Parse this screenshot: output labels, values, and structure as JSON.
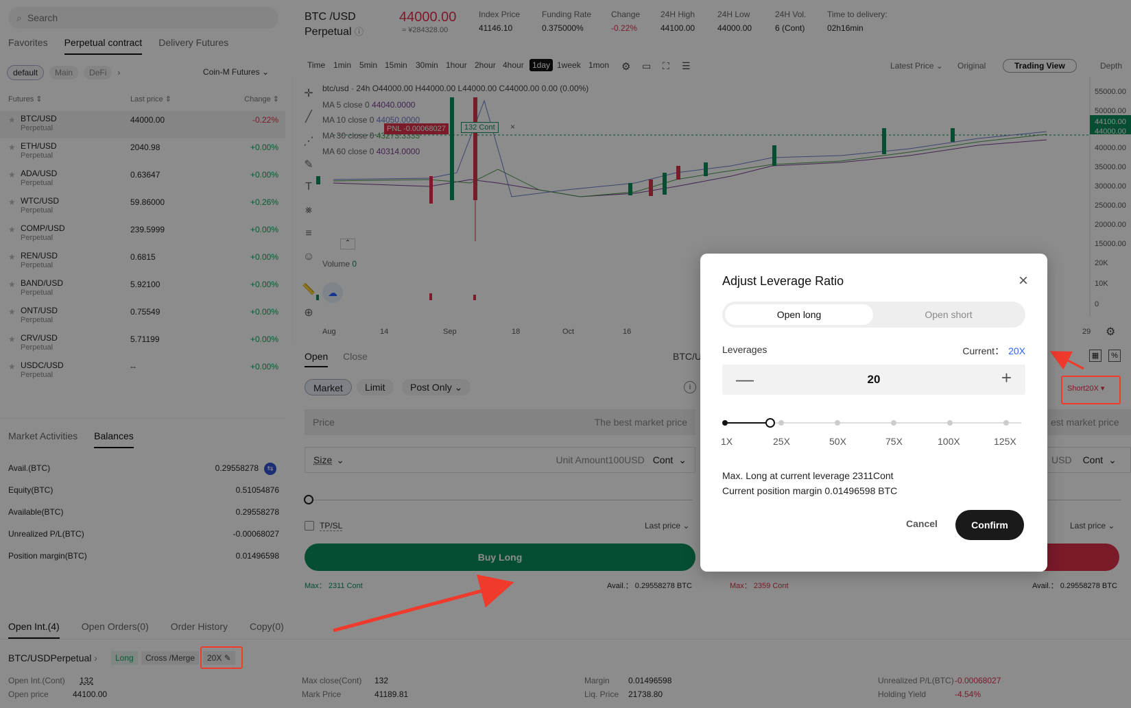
{
  "sidebar": {
    "search_placeholder": "Search",
    "tabs": [
      "Favorites",
      "Perpetual contract",
      "Delivery Futures"
    ],
    "chips": [
      "default",
      "Main",
      "DeFi"
    ],
    "coinm": "Coin-M Futures",
    "head": {
      "futures": "Futures",
      "last": "Last price",
      "change": "Change"
    },
    "items": [
      {
        "sym": "BTC/USD",
        "sub": "Perpetual",
        "px": "44000.00",
        "chg": "-0.22%"
      },
      {
        "sym": "ETH/USD",
        "sub": "Perpetual",
        "px": "2040.98",
        "chg": "+0.00%"
      },
      {
        "sym": "ADA/USD",
        "sub": "Perpetual",
        "px": "0.63647",
        "chg": "+0.00%"
      },
      {
        "sym": "WTC/USD",
        "sub": "Perpetual",
        "px": "59.86000",
        "chg": "+0.26%"
      },
      {
        "sym": "COMP/USD",
        "sub": "Perpetual",
        "px": "239.5999",
        "chg": "+0.00%"
      },
      {
        "sym": "REN/USD",
        "sub": "Perpetual",
        "px": "0.6815",
        "chg": "+0.00%"
      },
      {
        "sym": "BAND/USD",
        "sub": "Perpetual",
        "px": "5.92100",
        "chg": "+0.00%"
      },
      {
        "sym": "ONT/USD",
        "sub": "Perpetual",
        "px": "0.75549",
        "chg": "+0.00%"
      },
      {
        "sym": "CRV/USD",
        "sub": "Perpetual",
        "px": "5.71199",
        "chg": "+0.00%"
      },
      {
        "sym": "USDC/USD",
        "sub": "Perpetual",
        "px": "--",
        "chg": "+0.00%"
      }
    ],
    "bal_tabs": [
      "Market Activities",
      "Balances"
    ],
    "balances": [
      {
        "k": "Avail.(BTC)",
        "v": "0.29558278"
      },
      {
        "k": "Equity(BTC)",
        "v": "0.51054876"
      },
      {
        "k": "Available(BTC)",
        "v": "0.29558278"
      },
      {
        "k": "Unrealized P/L(BTC)",
        "v": "-0.00068027"
      },
      {
        "k": "Position margin(BTC)",
        "v": "0.01496598"
      }
    ]
  },
  "header": {
    "sym1": "BTC /USD",
    "sym2": "Perpetual",
    "price": "44000.00",
    "cny": "≈ ¥284328.00",
    "stats": [
      {
        "l": "Index Price",
        "v": "41146.10"
      },
      {
        "l": "Funding Rate",
        "v": "0.375000%"
      },
      {
        "l": "Change",
        "v": "-0.22%"
      },
      {
        "l": "24H High",
        "v": "44100.00"
      },
      {
        "l": "24H Low",
        "v": "44000.00"
      },
      {
        "l": "24H Vol.",
        "v": "6 (Cont)"
      },
      {
        "l": "Time to delivery:",
        "v": "02h16min"
      }
    ]
  },
  "toolbar": {
    "tfs": [
      "Time",
      "1min",
      "5min",
      "15min",
      "30min",
      "1hour",
      "2hour",
      "4hour",
      "1day",
      "1week",
      "1mon"
    ],
    "active_tf": "1day",
    "latest": "Latest Price",
    "original": "Original",
    "tv": "Trading View",
    "depth": "Depth"
  },
  "chart": {
    "ohlc": "btc/usd · 24h  O44000.00 H44000.00 L44000.00 C44000.00 0.00 (0.00%)",
    "ma": [
      {
        "l": "MA 5 close 0",
        "v": "44040.0000"
      },
      {
        "l": "MA 10 close 0",
        "v": "44050.0000"
      },
      {
        "l": "MA 30 close 0",
        "v": "43273.3333"
      },
      {
        "l": "MA 60 close 0",
        "v": "40314.0000"
      }
    ],
    "pnl": "PNL -0.00068027",
    "pnl_cont": "132 Cont",
    "volume": "Volume",
    "volume_v": "0",
    "yticks": [
      "55000.00",
      "50000.00",
      "44100.00",
      "44000.00",
      "40000.00",
      "35000.00",
      "30000.00",
      "25000.00",
      "20000.00",
      "15000.00",
      "20K",
      "10K",
      "0"
    ],
    "xticks": [
      "Aug",
      "14",
      "Sep",
      "18",
      "Oct",
      "16",
      "29"
    ]
  },
  "trade": {
    "tabs": [
      "Open",
      "Close"
    ],
    "pair": "BTC/U",
    "types": [
      "Market",
      "Limit",
      "Post Only"
    ],
    "price_label": "Price",
    "price_ph": "The best market price",
    "price_ph2": "est market price",
    "size_label": "Size",
    "unit_ph": "Unit Amount100USD",
    "unit": "Cont",
    "usd2": "USD",
    "tpsl": "TP/SL",
    "last_price": "Last price",
    "buy": "Buy Long",
    "max_l": "Max： 2311 Cont",
    "avail_l": "Avail.： 0.29558278 BTC",
    "max_s": "Max： 2359 Cont",
    "avail_s": "Avail.： 0.29558278 BTC",
    "short_badge": "Short20X"
  },
  "bottom": {
    "tabs": [
      "Open Int.(4)",
      "Open Orders(0)",
      "Order History",
      "Copy(0)"
    ],
    "pair": "BTC/USDPerpetual",
    "tag_long": "Long",
    "tag_mode": "Cross /Merge",
    "tag_lev": "20X",
    "rows": [
      {
        "l": "Open Int.(Cont)",
        "v": "132"
      },
      {
        "l": "Open price",
        "v": "44100.00"
      },
      {
        "l": "Max close(Cont)",
        "v": "132"
      },
      {
        "l": "Mark Price",
        "v": "41189.81"
      },
      {
        "l": "Margin",
        "v": "0.01496598"
      },
      {
        "l": "Liq. Price",
        "v": "21738.80"
      },
      {
        "l": "Unrealized P/L(BTC)",
        "v": "-0.00068027"
      },
      {
        "l": "Holding Yield",
        "v": "-4.54%"
      }
    ]
  },
  "modal": {
    "title": "Adjust Leverage Ratio",
    "seg_on": "Open long",
    "seg_off": "Open short",
    "lev_label": "Leverages",
    "current_label": "Current：",
    "current_val": "20X",
    "value": "20",
    "marks": [
      "1X",
      "25X",
      "50X",
      "75X",
      "100X",
      "125X"
    ],
    "slider_fraction": 0.16,
    "info1": "Max. Long at current leverage 2311Cont",
    "info2": "Current position margin 0.01496598 BTC",
    "cancel": "Cancel",
    "confirm": "Confirm"
  },
  "colors": {
    "accent": "#2962ff",
    "long": "#0a8f5a",
    "short": "#e0314b",
    "annotation": "#f03a2c"
  }
}
